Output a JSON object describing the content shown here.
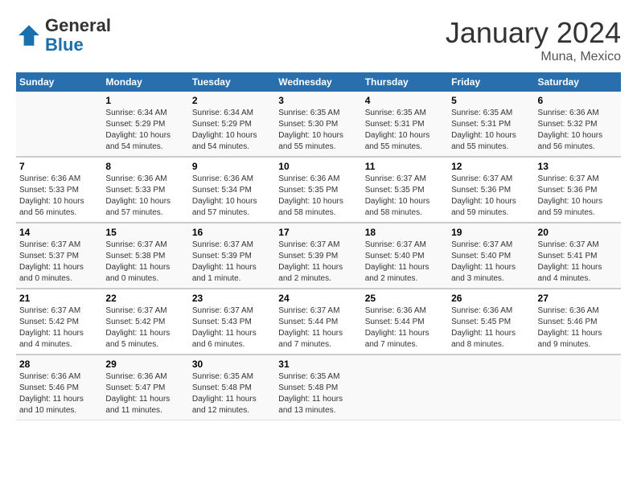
{
  "logo": {
    "general": "General",
    "blue": "Blue"
  },
  "title": "January 2024",
  "subtitle": "Muna, Mexico",
  "days_header": [
    "Sunday",
    "Monday",
    "Tuesday",
    "Wednesday",
    "Thursday",
    "Friday",
    "Saturday"
  ],
  "weeks": [
    [
      {
        "num": "",
        "info": ""
      },
      {
        "num": "1",
        "info": "Sunrise: 6:34 AM\nSunset: 5:29 PM\nDaylight: 10 hours\nand 54 minutes."
      },
      {
        "num": "2",
        "info": "Sunrise: 6:34 AM\nSunset: 5:29 PM\nDaylight: 10 hours\nand 54 minutes."
      },
      {
        "num": "3",
        "info": "Sunrise: 6:35 AM\nSunset: 5:30 PM\nDaylight: 10 hours\nand 55 minutes."
      },
      {
        "num": "4",
        "info": "Sunrise: 6:35 AM\nSunset: 5:31 PM\nDaylight: 10 hours\nand 55 minutes."
      },
      {
        "num": "5",
        "info": "Sunrise: 6:35 AM\nSunset: 5:31 PM\nDaylight: 10 hours\nand 55 minutes."
      },
      {
        "num": "6",
        "info": "Sunrise: 6:36 AM\nSunset: 5:32 PM\nDaylight: 10 hours\nand 56 minutes."
      }
    ],
    [
      {
        "num": "7",
        "info": "Sunrise: 6:36 AM\nSunset: 5:33 PM\nDaylight: 10 hours\nand 56 minutes."
      },
      {
        "num": "8",
        "info": "Sunrise: 6:36 AM\nSunset: 5:33 PM\nDaylight: 10 hours\nand 57 minutes."
      },
      {
        "num": "9",
        "info": "Sunrise: 6:36 AM\nSunset: 5:34 PM\nDaylight: 10 hours\nand 57 minutes."
      },
      {
        "num": "10",
        "info": "Sunrise: 6:36 AM\nSunset: 5:35 PM\nDaylight: 10 hours\nand 58 minutes."
      },
      {
        "num": "11",
        "info": "Sunrise: 6:37 AM\nSunset: 5:35 PM\nDaylight: 10 hours\nand 58 minutes."
      },
      {
        "num": "12",
        "info": "Sunrise: 6:37 AM\nSunset: 5:36 PM\nDaylight: 10 hours\nand 59 minutes."
      },
      {
        "num": "13",
        "info": "Sunrise: 6:37 AM\nSunset: 5:36 PM\nDaylight: 10 hours\nand 59 minutes."
      }
    ],
    [
      {
        "num": "14",
        "info": "Sunrise: 6:37 AM\nSunset: 5:37 PM\nDaylight: 11 hours\nand 0 minutes."
      },
      {
        "num": "15",
        "info": "Sunrise: 6:37 AM\nSunset: 5:38 PM\nDaylight: 11 hours\nand 0 minutes."
      },
      {
        "num": "16",
        "info": "Sunrise: 6:37 AM\nSunset: 5:39 PM\nDaylight: 11 hours\nand 1 minute."
      },
      {
        "num": "17",
        "info": "Sunrise: 6:37 AM\nSunset: 5:39 PM\nDaylight: 11 hours\nand 2 minutes."
      },
      {
        "num": "18",
        "info": "Sunrise: 6:37 AM\nSunset: 5:40 PM\nDaylight: 11 hours\nand 2 minutes."
      },
      {
        "num": "19",
        "info": "Sunrise: 6:37 AM\nSunset: 5:40 PM\nDaylight: 11 hours\nand 3 minutes."
      },
      {
        "num": "20",
        "info": "Sunrise: 6:37 AM\nSunset: 5:41 PM\nDaylight: 11 hours\nand 4 minutes."
      }
    ],
    [
      {
        "num": "21",
        "info": "Sunrise: 6:37 AM\nSunset: 5:42 PM\nDaylight: 11 hours\nand 4 minutes."
      },
      {
        "num": "22",
        "info": "Sunrise: 6:37 AM\nSunset: 5:42 PM\nDaylight: 11 hours\nand 5 minutes."
      },
      {
        "num": "23",
        "info": "Sunrise: 6:37 AM\nSunset: 5:43 PM\nDaylight: 11 hours\nand 6 minutes."
      },
      {
        "num": "24",
        "info": "Sunrise: 6:37 AM\nSunset: 5:44 PM\nDaylight: 11 hours\nand 7 minutes."
      },
      {
        "num": "25",
        "info": "Sunrise: 6:36 AM\nSunset: 5:44 PM\nDaylight: 11 hours\nand 7 minutes."
      },
      {
        "num": "26",
        "info": "Sunrise: 6:36 AM\nSunset: 5:45 PM\nDaylight: 11 hours\nand 8 minutes."
      },
      {
        "num": "27",
        "info": "Sunrise: 6:36 AM\nSunset: 5:46 PM\nDaylight: 11 hours\nand 9 minutes."
      }
    ],
    [
      {
        "num": "28",
        "info": "Sunrise: 6:36 AM\nSunset: 5:46 PM\nDaylight: 11 hours\nand 10 minutes."
      },
      {
        "num": "29",
        "info": "Sunrise: 6:36 AM\nSunset: 5:47 PM\nDaylight: 11 hours\nand 11 minutes."
      },
      {
        "num": "30",
        "info": "Sunrise: 6:35 AM\nSunset: 5:48 PM\nDaylight: 11 hours\nand 12 minutes."
      },
      {
        "num": "31",
        "info": "Sunrise: 6:35 AM\nSunset: 5:48 PM\nDaylight: 11 hours\nand 13 minutes."
      },
      {
        "num": "",
        "info": ""
      },
      {
        "num": "",
        "info": ""
      },
      {
        "num": "",
        "info": ""
      }
    ]
  ]
}
